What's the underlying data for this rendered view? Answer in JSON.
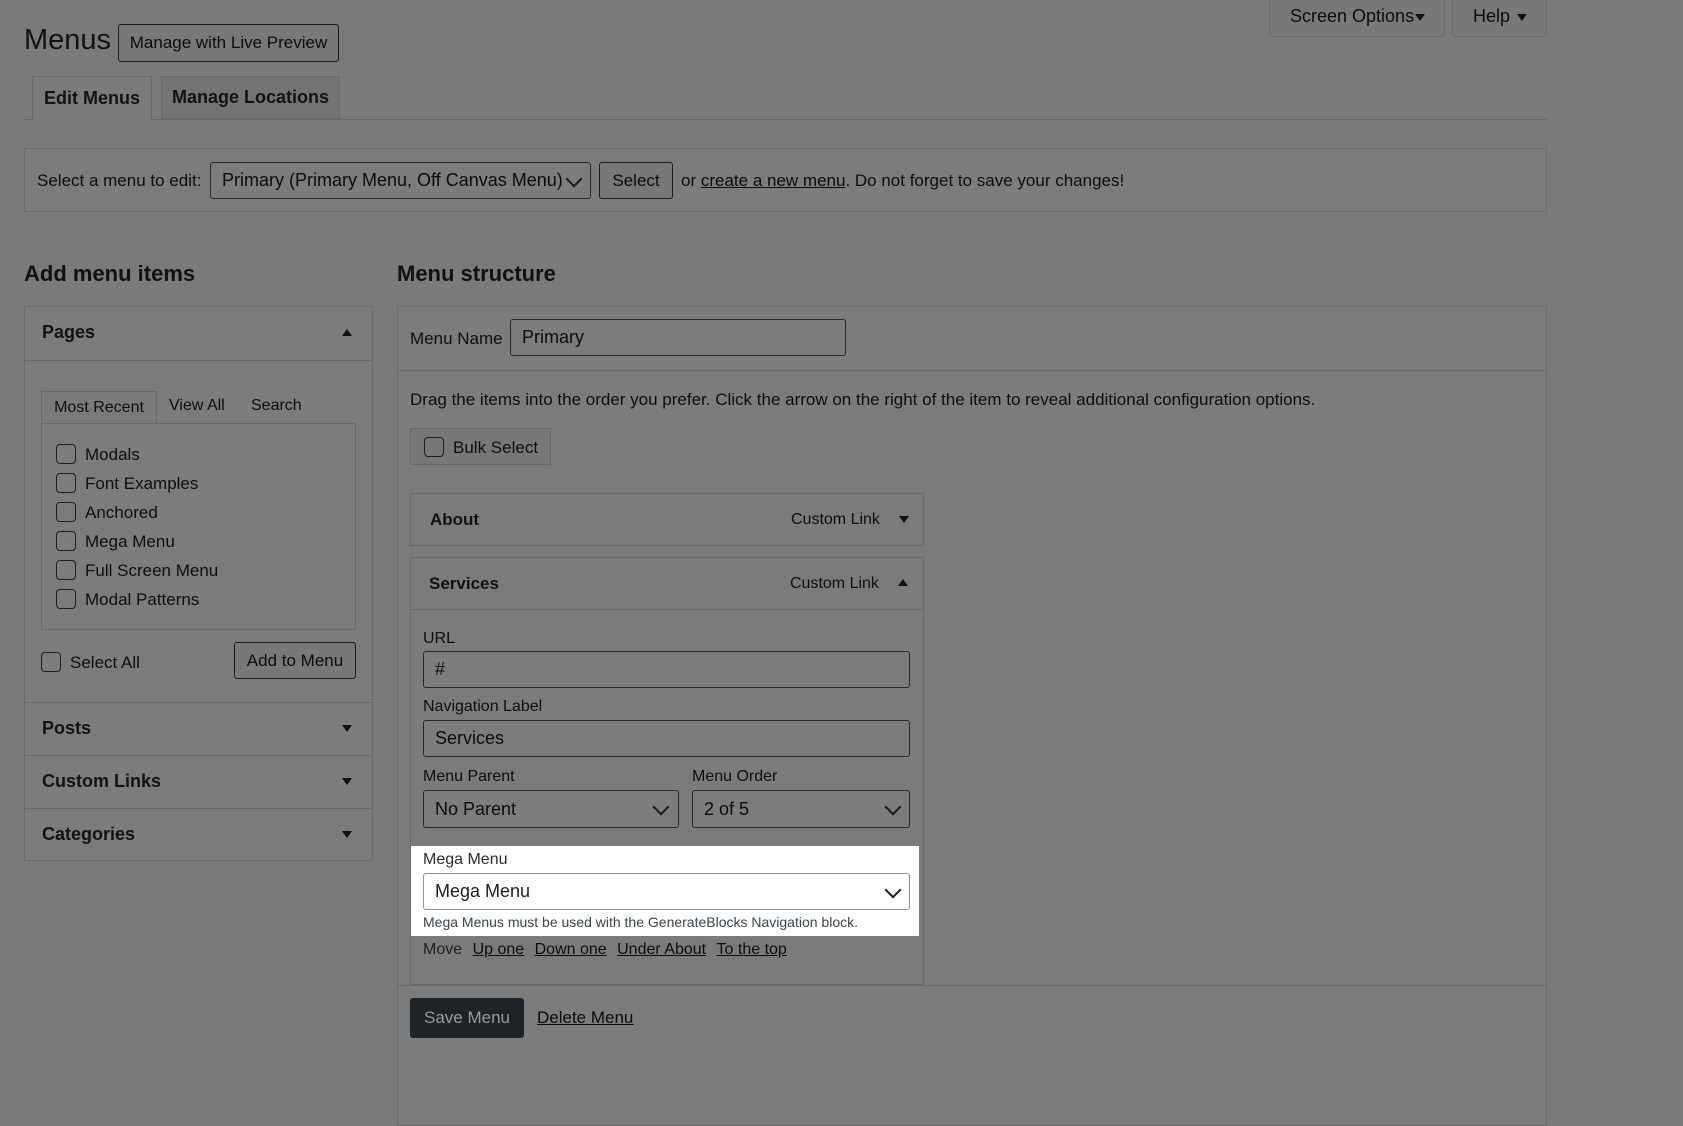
{
  "header": {
    "title": "Menus",
    "live_preview_label": "Manage with Live Preview",
    "screen_options_label": "Screen Options",
    "help_label": "Help"
  },
  "tabs": [
    {
      "label": "Edit Menus",
      "active": true
    },
    {
      "label": "Manage Locations",
      "active": false
    }
  ],
  "select_bar": {
    "prompt": "Select a menu to edit:",
    "selected_menu": "Primary (Primary Menu, Off Canvas Menu)",
    "select_label": "Select",
    "or_text": "or",
    "create_link": "create a new menu",
    "reminder": ". Do not forget to save your changes!"
  },
  "add_items": {
    "title": "Add menu items",
    "pages": {
      "title": "Pages",
      "tabs": [
        "Most Recent",
        "View All",
        "Search"
      ],
      "items": [
        "Modals",
        "Font Examples",
        "Anchored",
        "Mega Menu",
        "Full Screen Menu",
        "Modal Patterns"
      ],
      "select_all_label": "Select All",
      "add_button_label": "Add to Menu"
    },
    "collapsed_sections": [
      "Posts",
      "Custom Links",
      "Categories"
    ]
  },
  "structure": {
    "title": "Menu structure",
    "menu_name_label": "Menu Name",
    "menu_name_value": "Primary",
    "instructions": "Drag the items into the order you prefer. Click the arrow on the right of the item to reveal additional configuration options.",
    "bulk_select_label": "Bulk Select",
    "items": [
      {
        "title": "About",
        "type": "Custom Link",
        "expanded": false
      },
      {
        "title": "Services",
        "type": "Custom Link",
        "expanded": true
      }
    ],
    "services": {
      "url_label": "URL",
      "url_value": "#",
      "nav_label_label": "Navigation Label",
      "nav_label_value": "Services",
      "parent_label": "Menu Parent",
      "parent_value": "No Parent",
      "order_label": "Menu Order",
      "order_value": "2 of 5",
      "mega_label": "Mega Menu",
      "mega_value": "Mega Menu",
      "mega_note": "Mega Menus must be used with the GenerateBlocks Navigation block.",
      "move_label": "Move",
      "move_links": [
        "Up one",
        "Down one",
        "Under About",
        "To the top"
      ]
    },
    "save_label": "Save Menu",
    "delete_label": "Delete Menu"
  }
}
